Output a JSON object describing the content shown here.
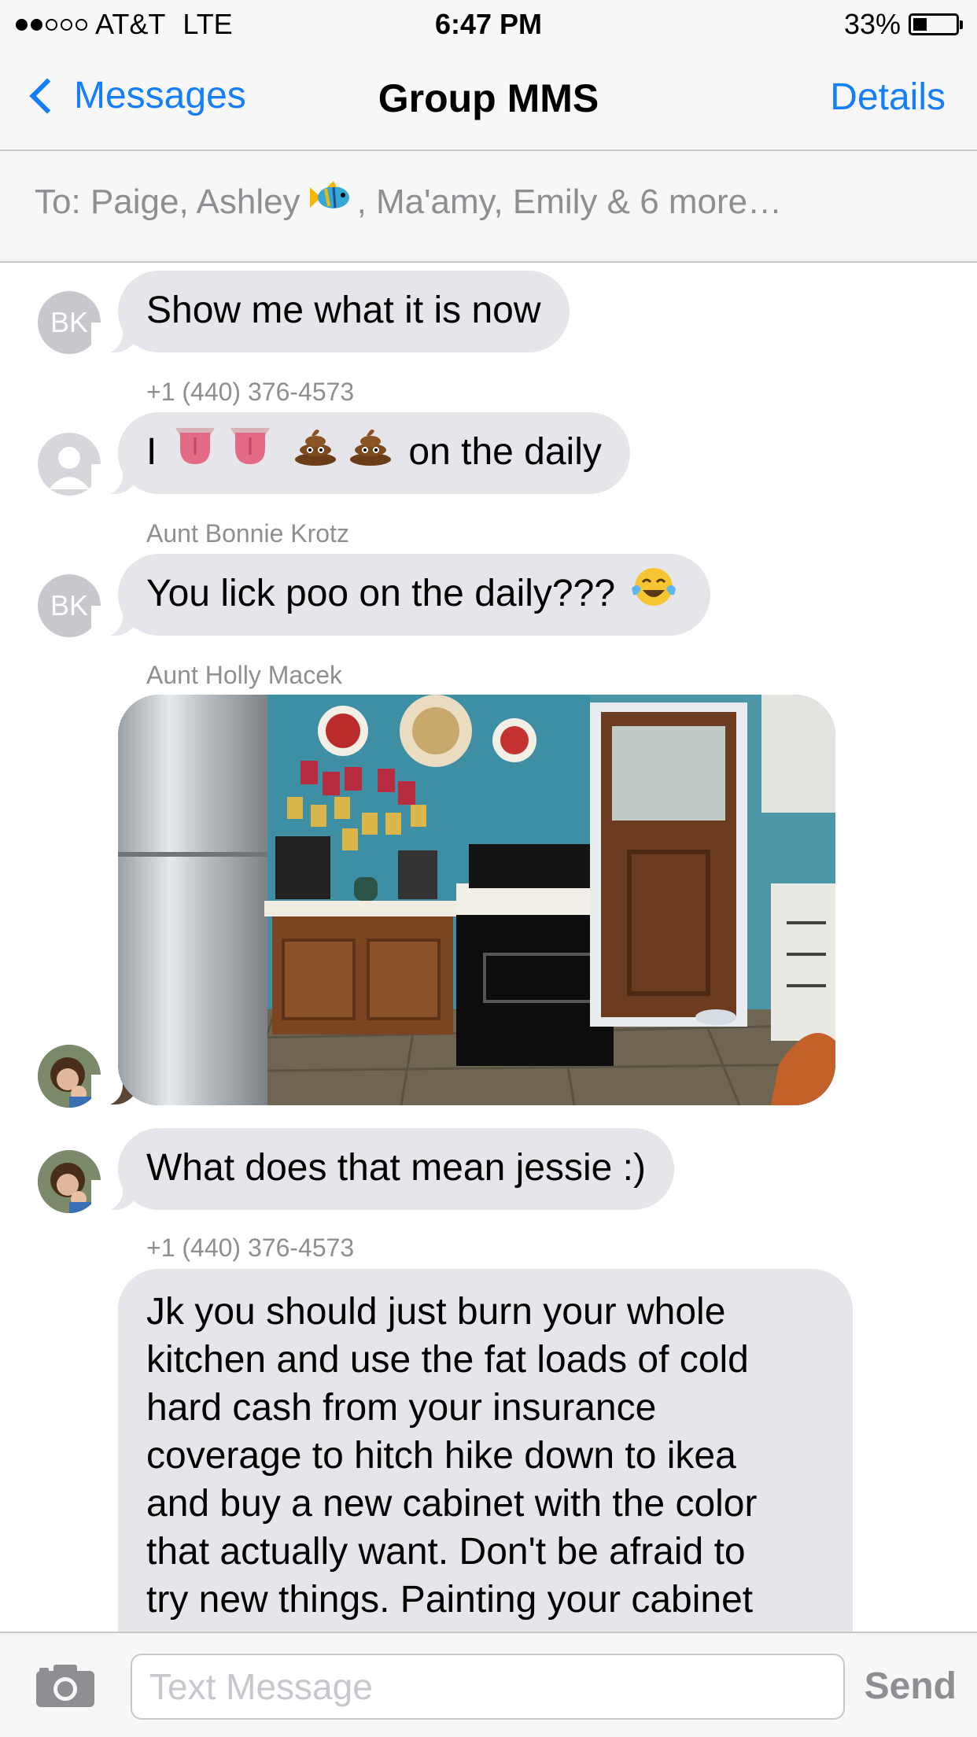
{
  "status": {
    "carrier": "AT&T",
    "network": "LTE",
    "time": "6:47 PM",
    "battery": "33%",
    "battery_level": 0.33,
    "signal_bars": 2
  },
  "nav": {
    "back_label": "Messages",
    "title": "Group MMS",
    "details_label": "Details"
  },
  "recipients": {
    "prefix": "To:",
    "part1": "Paige, Ashley",
    "part2": ", Ma'amy, Emily & 6 more…"
  },
  "messages": [
    {
      "avatar": "BK",
      "text": "Show me what it is now"
    },
    {
      "sender": "+1 (440) 376-4573",
      "text_start": "I",
      "text_end": "on the daily"
    },
    {
      "sender": "Aunt Bonnie Krotz",
      "avatar": "BK",
      "text": "You lick poo on the daily???"
    },
    {
      "sender": "Aunt Holly Macek",
      "attachment": "kitchen-photo"
    },
    {
      "text": "What does that mean jessie :)"
    },
    {
      "sender": "+1 (440) 376-4573",
      "lines": [
        "Jk you should just burn your whole",
        "kitchen and use the fat loads of cold",
        "hard cash from your insurance",
        "coverage to hitch hike down to ikea",
        "and buy a new cabinet with the color",
        "that actually want. Don't be afraid to",
        "try new things. Painting your cabinet"
      ]
    }
  ],
  "compose": {
    "placeholder": "Text Message",
    "send_label": "Send"
  },
  "colors": {
    "accent": "#157efb",
    "bubble": "#e5e5ea",
    "secondary_text": "#8e8e93"
  }
}
